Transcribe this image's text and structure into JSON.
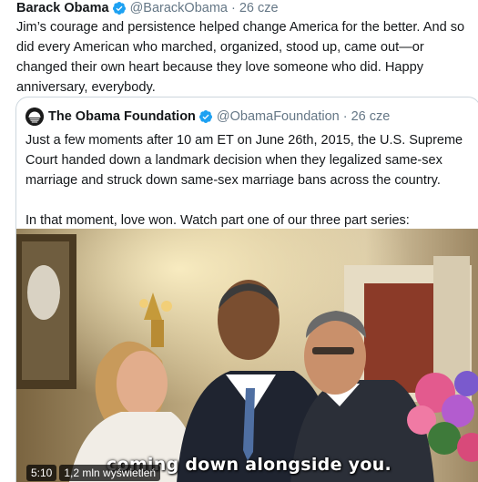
{
  "tweet": {
    "author_name": "Barack Obama",
    "handle": "@BarackObama",
    "separator": "·",
    "date": "26 cze",
    "text": "Jim’s courage and persistence helped change America for the better. And so did every American who marched, organized, stood up, came out—or changed their own heart because they love someone who did. Happy anniversary, everybody."
  },
  "quote": {
    "author_name": "The Obama Foundation",
    "handle": "@ObamaFoundation",
    "separator": "·",
    "date": "26 cze",
    "paragraph_1": "Just a few moments after 10 am ET on June 26th, 2015, the U.S. Supreme Court handed down a landmark decision when they legalized same-sex marriage and struck down same-sex marriage bans across the country.",
    "paragraph_2": "In that moment, love won. Watch part one of our three part series:"
  },
  "video": {
    "caption": "coming down alongside you.",
    "duration": "5:10",
    "views": "1,2 mln wyświetleń"
  },
  "icons": {
    "verified": "verified-badge-icon",
    "foundation_logo": "obama-foundation-logo"
  },
  "colors": {
    "verified_blue": "#1da1f2",
    "secondary_text": "#657786",
    "border": "#ccd6dd"
  }
}
